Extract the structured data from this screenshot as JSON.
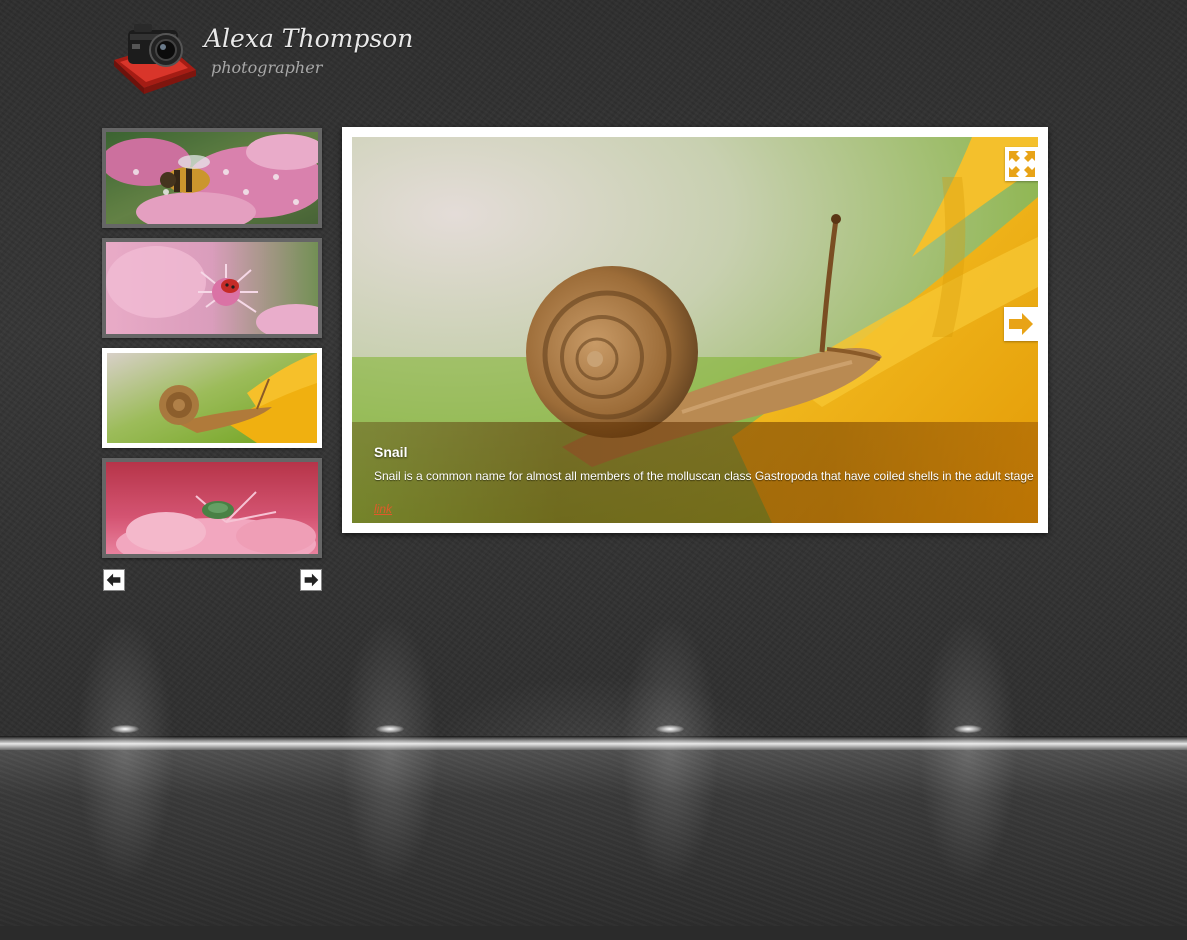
{
  "brand": {
    "name": "Alexa Thompson",
    "tagline": "photographer"
  },
  "thumbnails": [
    {
      "subject": "bee-on-pink-flower",
      "active": false
    },
    {
      "subject": "ladybug-on-pink-flower",
      "active": false
    },
    {
      "subject": "snail-on-yellow-petal",
      "active": true
    },
    {
      "subject": "beetle-on-pink-flower",
      "active": false
    }
  ],
  "thumb_nav": {
    "prev_icon": "arrow-left-icon",
    "next_icon": "arrow-right-icon"
  },
  "slide": {
    "title": "Snail",
    "description": "Snail is a common name for almost all members of the molluscan class Gastropoda that have coiled shells in the adult stage",
    "link_label": "link",
    "fullscreen_icon": "fullscreen-icon",
    "next_icon": "arrow-right-icon"
  },
  "colors": {
    "accent": "#e8a317",
    "link": "#e05a2a",
    "logo_red": "#c8281e"
  }
}
